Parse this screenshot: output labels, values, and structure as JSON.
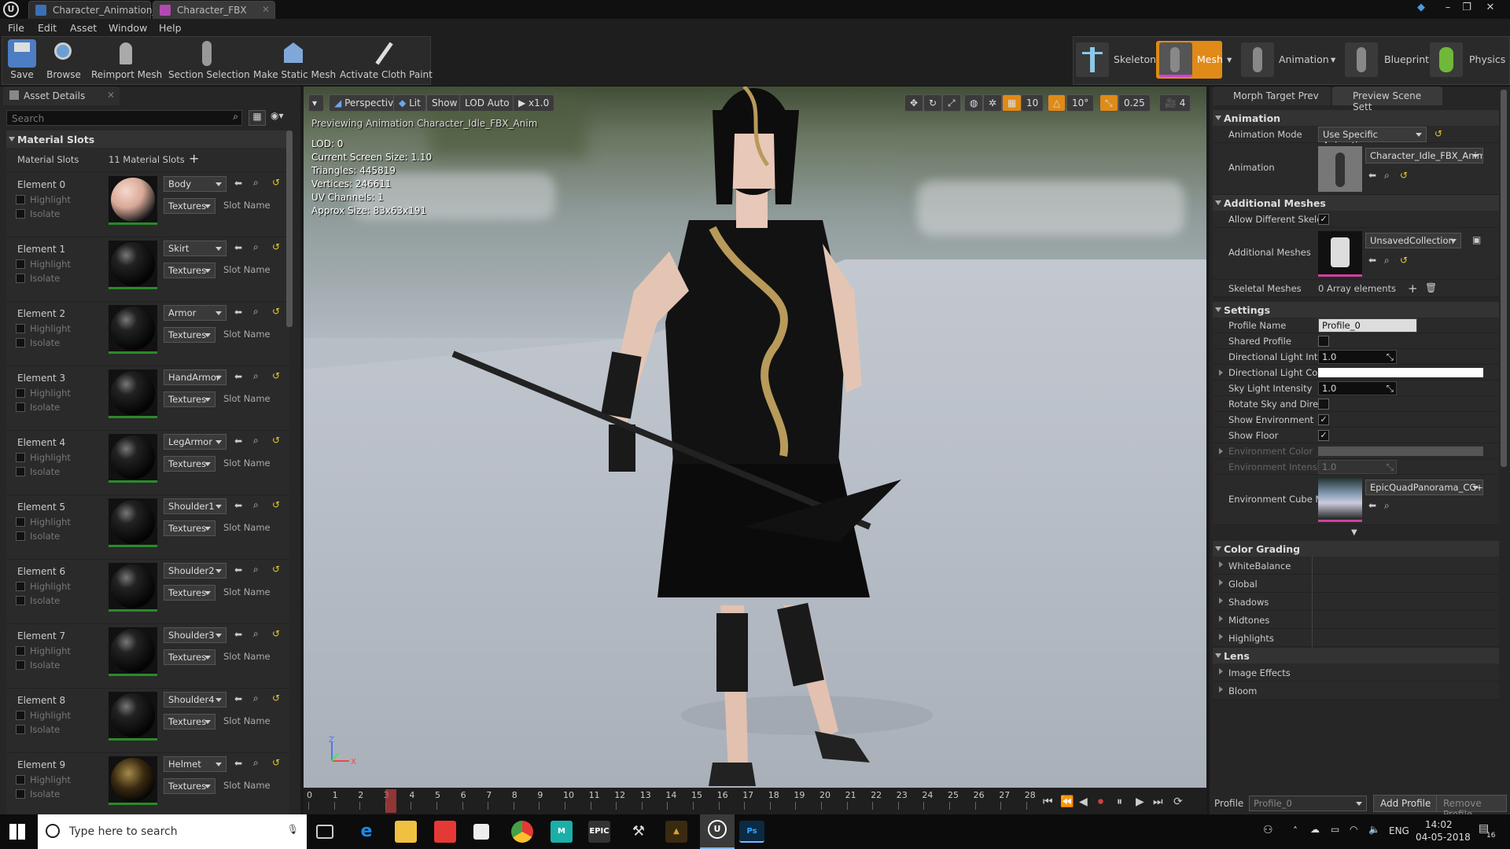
{
  "window": {
    "tabs": [
      {
        "label": "Character_Animation_BP",
        "icon": "blueprint-icon"
      },
      {
        "label": "Character_FBX",
        "icon": "mesh-icon"
      }
    ]
  },
  "menu": [
    "File",
    "Edit",
    "Asset",
    "Window",
    "Help"
  ],
  "toolbar": {
    "buttons": [
      {
        "label": "Save",
        "icon": "save-icon"
      },
      {
        "label": "Browse",
        "icon": "browse-icon"
      },
      {
        "label": "Reimport Mesh",
        "icon": "reimport-icon"
      },
      {
        "label": "Section Selection",
        "icon": "section-selection-icon"
      },
      {
        "label": "Make Static Mesh",
        "icon": "static-mesh-icon"
      },
      {
        "label": "Activate Cloth Paint",
        "icon": "cloth-paint-icon"
      }
    ],
    "modes": [
      {
        "label": "Skeleton"
      },
      {
        "label": "Mesh",
        "active": true
      },
      {
        "label": "Animation"
      },
      {
        "label": "Blueprint"
      },
      {
        "label": "Physics"
      }
    ]
  },
  "left_panel": {
    "tab": "Asset Details",
    "search_placeholder": "Search",
    "section": "Material Slots",
    "material_slots_label": "Material Slots",
    "material_slots_count": "11 Material Slots",
    "highlight_label": "Highlight",
    "isolate_label": "Isolate",
    "textures_label": "Textures",
    "slot_name_label": "Slot Name",
    "elements": [
      {
        "name": "Element 0",
        "material": "Body"
      },
      {
        "name": "Element 1",
        "material": "Skirt"
      },
      {
        "name": "Element 2",
        "material": "Armor"
      },
      {
        "name": "Element 3",
        "material": "HandArmor"
      },
      {
        "name": "Element 4",
        "material": "LegArmor"
      },
      {
        "name": "Element 5",
        "material": "Shoulder1"
      },
      {
        "name": "Element 6",
        "material": "Shoulder2"
      },
      {
        "name": "Element 7",
        "material": "Shoulder3"
      },
      {
        "name": "Element 8",
        "material": "Shoulder4"
      },
      {
        "name": "Element 9",
        "material": "Helmet"
      }
    ]
  },
  "viewport": {
    "buttons": {
      "perspective": "Perspective",
      "lit": "Lit",
      "show": "Show",
      "lod": "LOD Auto",
      "speed": "x1.0"
    },
    "snap": {
      "grid": "10",
      "rotation": "10°",
      "scale": "0.25",
      "camera": "4"
    },
    "preview_text": "Previewing Animation Character_Idle_FBX_Anim",
    "stats": [
      "LOD: 0",
      "Current Screen Size: 1.10",
      "Triangles: 445819",
      "Vertices: 246611",
      "UV Channels: 1",
      "Approx Size: 83x63x191"
    ],
    "axis": {
      "x": "X",
      "z": "Z"
    }
  },
  "timeline": {
    "frames": [
      "0",
      "1",
      "2",
      "3",
      "4",
      "5",
      "6",
      "7",
      "8",
      "9",
      "10",
      "11",
      "12",
      "13",
      "14",
      "15",
      "16",
      "17",
      "18",
      "19",
      "20",
      "21",
      "22",
      "23",
      "24",
      "25",
      "26",
      "27",
      "28"
    ],
    "current_frame": 3
  },
  "right_panel": {
    "tabs": [
      "Morph Target Prev",
      "Preview Scene Sett"
    ],
    "animation": {
      "header": "Animation",
      "mode_label": "Animation Mode",
      "mode_value": "Use Specific Animation",
      "anim_label": "Animation",
      "anim_value": "Character_Idle_FBX_Anim"
    },
    "additional_meshes": {
      "header": "Additional Meshes",
      "allow_label": "Allow Different Skelet",
      "allow_checked": true,
      "meshes_label": "Additional Meshes",
      "meshes_value": "UnsavedCollection",
      "skeletal_label": "Skeletal Meshes",
      "skeletal_value": "0 Array elements"
    },
    "settings": {
      "header": "Settings",
      "rows": {
        "profile_name_label": "Profile Name",
        "profile_name_value": "Profile_0",
        "shared_profile_label": "Shared Profile",
        "dir_light_int_label": "Directional Light Inten",
        "dir_light_int_value": "1.0",
        "dir_light_col_label": "Directional Light Colo",
        "sky_light_label": "Sky Light Intensity",
        "sky_light_value": "1.0",
        "rotate_label": "Rotate Sky and Direct",
        "show_env_label": "Show Environment",
        "show_floor_label": "Show Floor",
        "env_color_label": "Environment Color",
        "env_intensity_label": "Environment Intensity",
        "env_intensity_value": "1.0",
        "env_cube_label": "Environment Cube Ma",
        "env_cube_value": "EpicQuadPanorama_CC+EV"
      },
      "checks": {
        "shared": false,
        "rotate": false,
        "show_env": true,
        "show_floor": true
      }
    },
    "color_grading": {
      "header": "Color Grading",
      "items": [
        "WhiteBalance",
        "Global",
        "Shadows",
        "Midtones",
        "Highlights"
      ]
    },
    "lens": {
      "header": "Lens",
      "items": [
        "Image Effects",
        "Bloom"
      ]
    },
    "footer": {
      "profile_label": "Profile",
      "profile_value": "Profile_0",
      "add": "Add Profile",
      "remove": "Remove Profile"
    }
  },
  "taskbar": {
    "search_placeholder": "Type here to search",
    "apps": [
      "task-view-icon",
      "edge-icon",
      "explorer-icon",
      "store-icon",
      "sticky-icon",
      "chrome-icon",
      "maya-icon",
      "epic-icon",
      "zbrush-icon",
      "marmoset-icon",
      "unreal-icon",
      "photoshop-icon"
    ],
    "app_labels": {
      "maya": "M",
      "epic": "EPIC",
      "photoshop": "Ps"
    },
    "language": "ENG",
    "time": "14:02",
    "date": "04-05-2018",
    "notifications": "16"
  }
}
